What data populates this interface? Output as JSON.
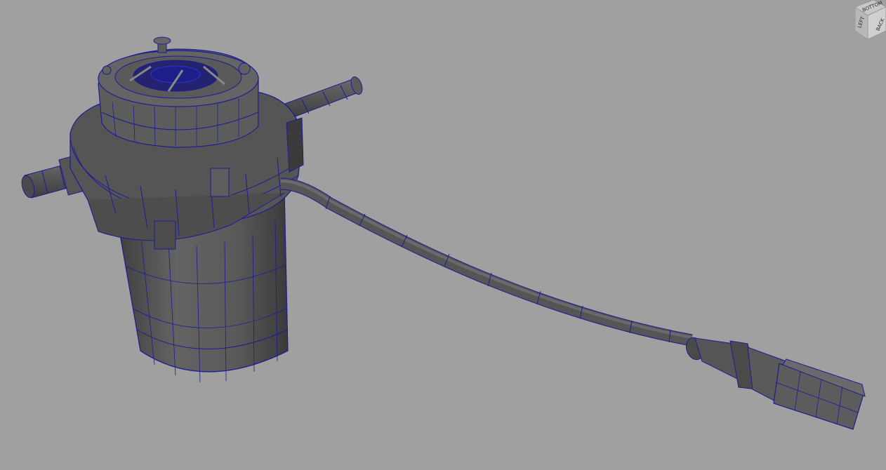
{
  "viewport": {
    "background": "#a0a0a0",
    "wire_color": "#1c1c96",
    "shade_color": "#555555"
  },
  "viewcube": {
    "top_label": "BOTTOM",
    "front_label": "BACK",
    "side_label": "LEFT"
  },
  "model": {
    "icon": "wireframe-shaded-mesh"
  }
}
